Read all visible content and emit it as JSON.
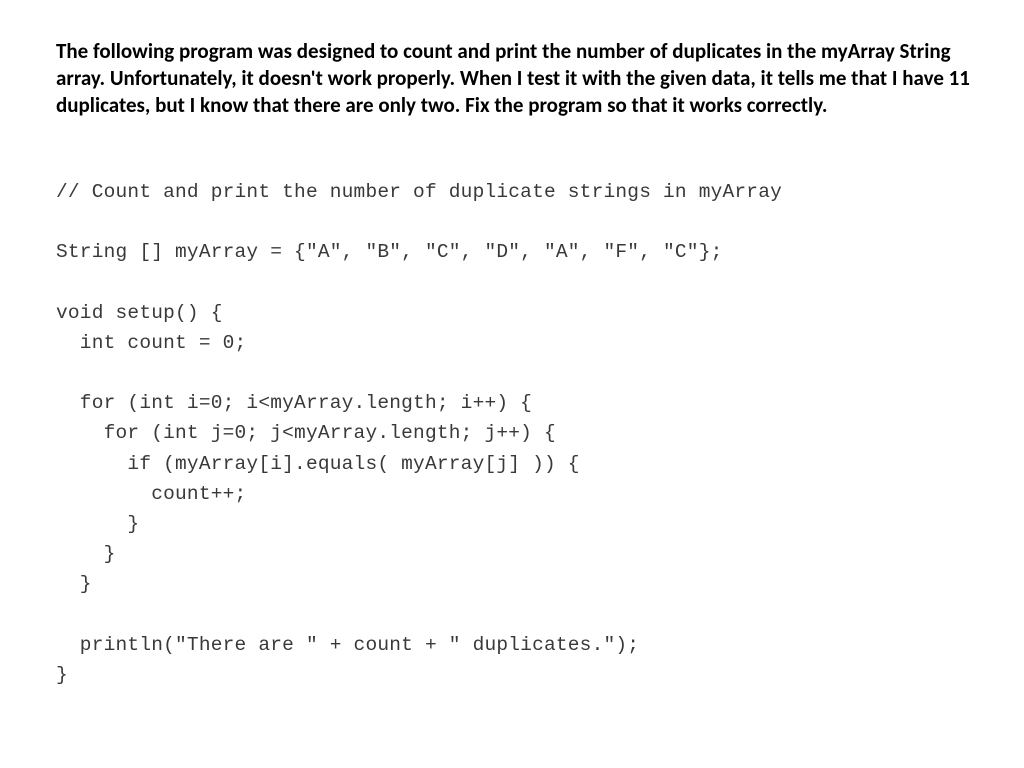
{
  "prompt": "The following program was designed to count and print the number of duplicates in the myArray String array. Unfortunately, it doesn't work properly. When I test it with the given data, it tells me that I have 11 duplicates, but I know that there are only two. Fix the program so that it works correctly.",
  "code": "// Count and print the number of duplicate strings in myArray\n\nString [] myArray = {\"A\", \"B\", \"C\", \"D\", \"A\", \"F\", \"C\"};\n\nvoid setup() {\n  int count = 0;\n\n  for (int i=0; i<myArray.length; i++) {\n    for (int j=0; j<myArray.length; j++) {\n      if (myArray[i].equals( myArray[j] )) {\n        count++;\n      }\n    }\n  }\n\n  println(\"There are \" + count + \" duplicates.\");\n}"
}
